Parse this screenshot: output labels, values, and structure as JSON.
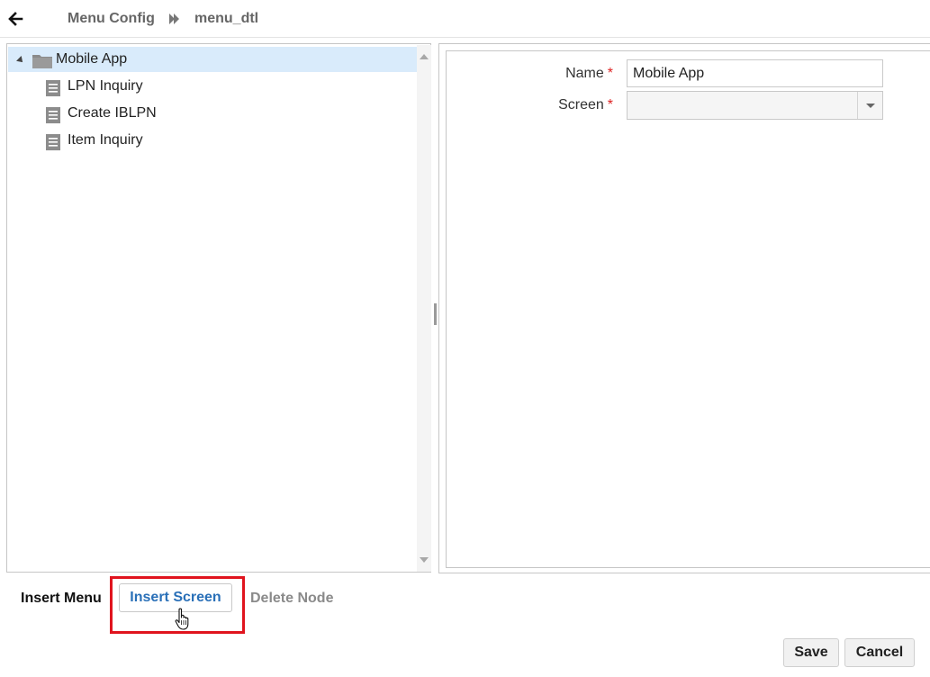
{
  "header": {
    "breadcrumb": [
      "Menu Config",
      "menu_dtl"
    ]
  },
  "tree": {
    "root": {
      "label": "Mobile App",
      "icon": "folder-icon",
      "expanded": true,
      "selected": true
    },
    "children": [
      {
        "label": "LPN Inquiry",
        "icon": "document-icon"
      },
      {
        "label": "Create IBLPN",
        "icon": "document-icon"
      },
      {
        "label": "Item Inquiry",
        "icon": "document-icon"
      }
    ]
  },
  "form": {
    "name": {
      "label": "Name",
      "required_mark": "*",
      "value": "Mobile App"
    },
    "screen": {
      "label": "Screen",
      "required_mark": "*",
      "value": ""
    }
  },
  "actions": {
    "insert_menu": "Insert Menu",
    "insert_screen": "Insert Screen",
    "delete_node": "Delete Node",
    "save": "Save",
    "cancel": "Cancel"
  },
  "colors": {
    "accent": "#2a70b8",
    "selection": "#d9ebfb",
    "highlight": "#e0141e",
    "required": "#dd2222"
  }
}
